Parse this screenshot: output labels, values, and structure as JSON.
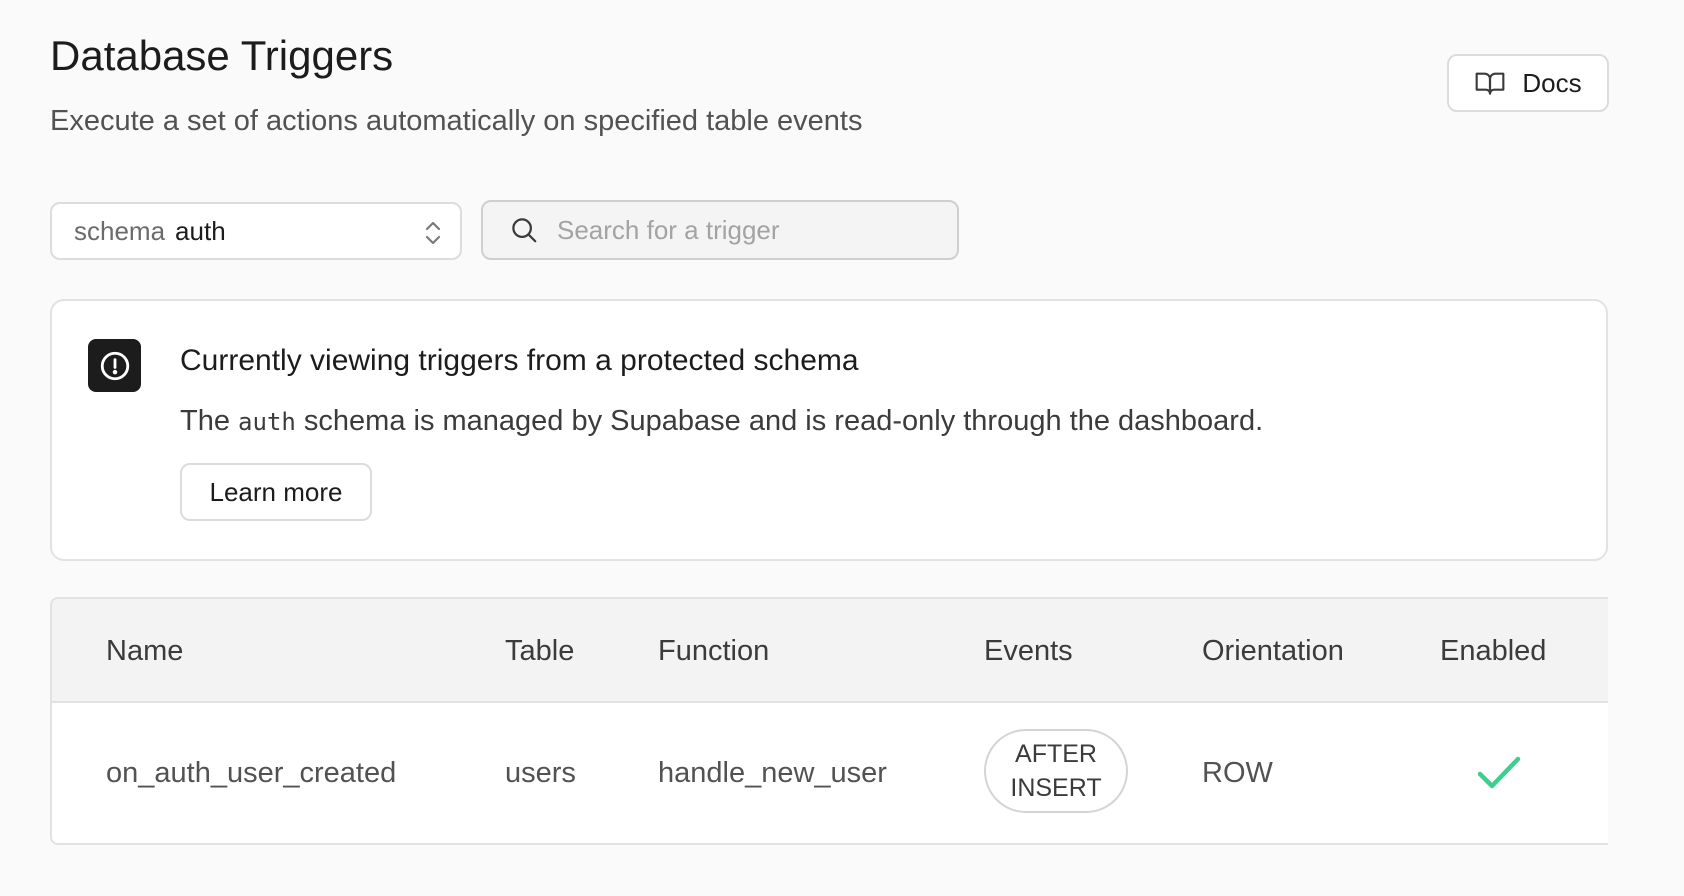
{
  "header": {
    "title": "Database Triggers",
    "subtitle": "Execute a set of actions automatically on specified table events",
    "docs_label": "Docs"
  },
  "filters": {
    "schema_prefix": "schema",
    "schema_value": "auth",
    "search_placeholder": "Search for a trigger",
    "search_value": ""
  },
  "alert": {
    "title": "Currently viewing triggers from a protected schema",
    "desc_before": "The",
    "desc_code": "auth",
    "desc_after": "schema is managed by Supabase and is read-only through the dashboard.",
    "learn_more_label": "Learn more"
  },
  "table": {
    "columns": [
      "Name",
      "Table",
      "Function",
      "Events",
      "Orientation",
      "Enabled"
    ],
    "rows": [
      {
        "name": "on_auth_user_created",
        "table": "users",
        "function": "handle_new_user",
        "events": "AFTER\nINSERT",
        "orientation": "ROW",
        "enabled": true
      }
    ]
  },
  "colors": {
    "accent_green": "#3ecf8e",
    "text_primary": "#1c1c1c",
    "text_muted": "#525252",
    "border": "#e2e2e2"
  },
  "icons": {
    "docs": "book-open-icon",
    "schema_select": "chevrons-up-down-icon",
    "search": "search-icon",
    "alert": "alert-circle-icon",
    "enabled": "check-icon"
  }
}
